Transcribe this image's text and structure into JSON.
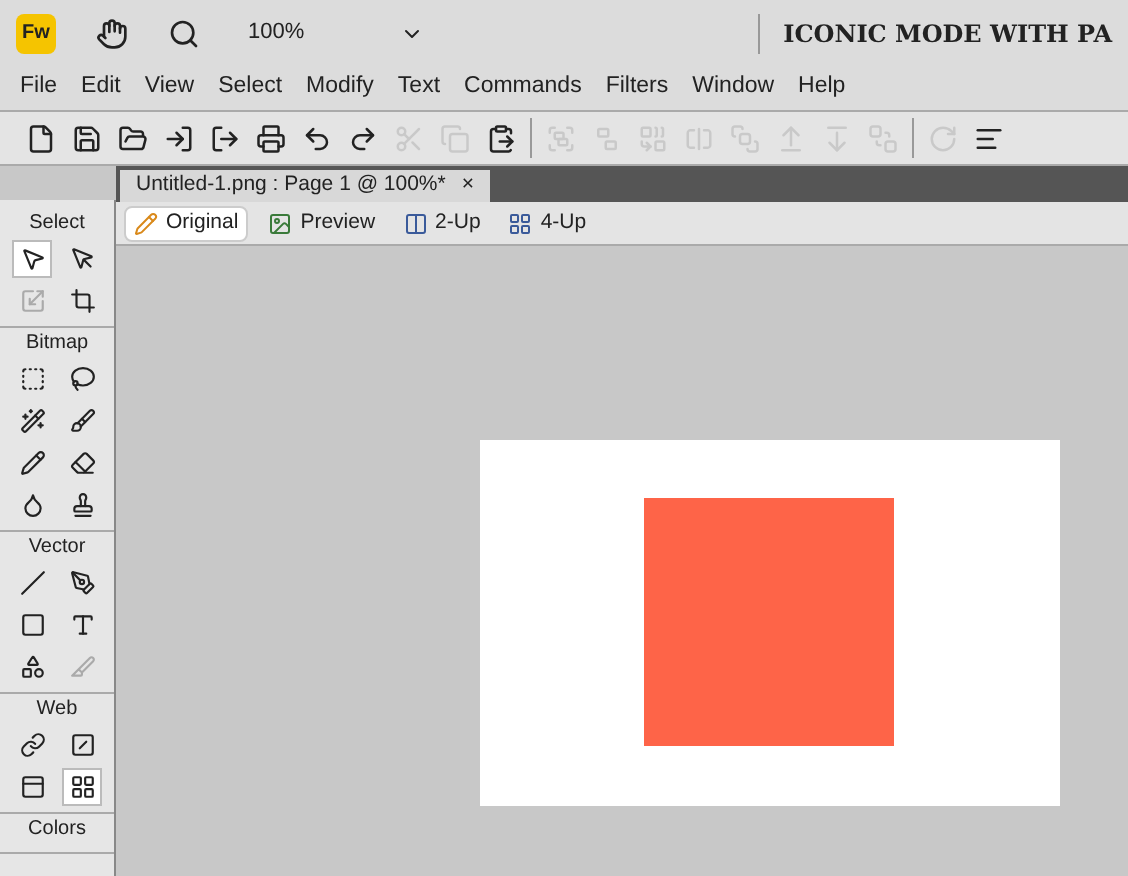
{
  "app_bar": {
    "logo": "Fw",
    "zoom": "100%",
    "title": "ICONIC MODE WITH PA"
  },
  "menu": [
    "File",
    "Edit",
    "View",
    "Select",
    "Modify",
    "Text",
    "Commands",
    "Filters",
    "Window",
    "Help"
  ],
  "toolbar": [
    {
      "kind": "new",
      "disabled": false
    },
    {
      "kind": "save",
      "disabled": false
    },
    {
      "kind": "open",
      "disabled": false
    },
    {
      "kind": "import",
      "disabled": false
    },
    {
      "kind": "export",
      "disabled": false
    },
    {
      "kind": "print",
      "disabled": false
    },
    {
      "kind": "undo",
      "disabled": false
    },
    {
      "kind": "redo",
      "disabled": false
    },
    {
      "kind": "cut",
      "disabled": true
    },
    {
      "kind": "copy",
      "disabled": true
    },
    {
      "kind": "paste",
      "disabled": false
    },
    {
      "kind": "separator"
    },
    {
      "kind": "group",
      "disabled": true
    },
    {
      "kind": "ungroup",
      "disabled": true
    },
    {
      "kind": "join",
      "disabled": true
    },
    {
      "kind": "split",
      "disabled": true
    },
    {
      "kind": "front",
      "disabled": true
    },
    {
      "kind": "forward",
      "disabled": true
    },
    {
      "kind": "backward",
      "disabled": true
    },
    {
      "kind": "back",
      "disabled": true
    },
    {
      "kind": "separator"
    },
    {
      "kind": "rotate",
      "disabled": true
    },
    {
      "kind": "align",
      "disabled": false
    }
  ],
  "document_tab": {
    "title": "Untitled-1.png : Page 1 @ 100%*",
    "close": "×"
  },
  "views": [
    {
      "kind": "pencil",
      "label": "Original",
      "selected": true
    },
    {
      "kind": "image",
      "label": "Preview",
      "selected": false
    },
    {
      "kind": "two",
      "label": "2-Up",
      "selected": false
    },
    {
      "kind": "four",
      "label": "4-Up",
      "selected": false
    }
  ],
  "tools_panel": [
    {
      "title": "Select",
      "tools": [
        {
          "kind": "pointer",
          "selected": true,
          "disabled": false
        },
        {
          "kind": "subselect",
          "selected": false,
          "disabled": false
        },
        {
          "kind": "scale",
          "selected": false,
          "disabled": true
        },
        {
          "kind": "crop",
          "selected": false,
          "disabled": false
        }
      ]
    },
    {
      "title": "Bitmap",
      "tools": [
        {
          "kind": "marquee",
          "selected": false,
          "disabled": false
        },
        {
          "kind": "lasso",
          "selected": false,
          "disabled": false
        },
        {
          "kind": "wand",
          "selected": false,
          "disabled": false
        },
        {
          "kind": "brush",
          "selected": false,
          "disabled": false
        },
        {
          "kind": "pencil",
          "selected": false,
          "disabled": false
        },
        {
          "kind": "eraser",
          "selected": false,
          "disabled": false
        },
        {
          "kind": "blur",
          "selected": false,
          "disabled": false
        },
        {
          "kind": "stamp",
          "selected": false,
          "disabled": false
        }
      ]
    },
    {
      "title": "Vector",
      "tools": [
        {
          "kind": "line",
          "selected": false,
          "disabled": false
        },
        {
          "kind": "pen",
          "selected": false,
          "disabled": false
        },
        {
          "kind": "rectangle",
          "selected": false,
          "disabled": false
        },
        {
          "kind": "text",
          "selected": false,
          "disabled": false
        },
        {
          "kind": "freeform",
          "selected": false,
          "disabled": false
        },
        {
          "kind": "knife",
          "selected": false,
          "disabled": true
        }
      ]
    },
    {
      "title": "Web",
      "tools": [
        {
          "kind": "hotspot",
          "selected": false,
          "disabled": false
        },
        {
          "kind": "slice",
          "selected": false,
          "disabled": false
        },
        {
          "kind": "hide-slices",
          "selected": false,
          "disabled": false
        },
        {
          "kind": "show-slices",
          "selected": true,
          "disabled": false
        }
      ]
    },
    {
      "title": "Colors"
    }
  ]
}
